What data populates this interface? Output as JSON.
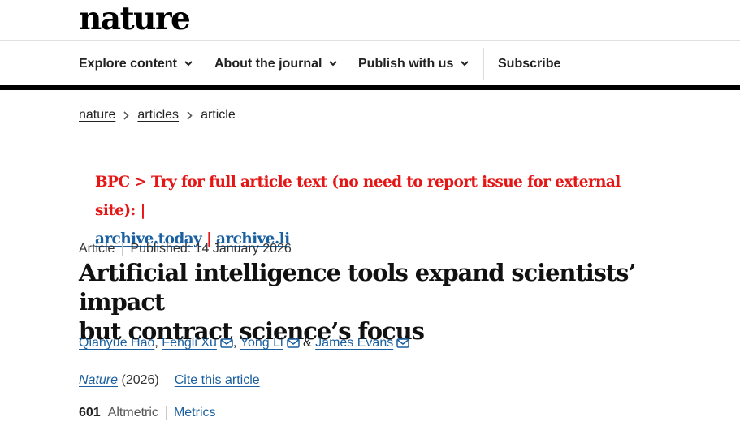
{
  "header": {
    "logo": "nature"
  },
  "nav": {
    "explore": "Explore content",
    "about": "About the journal",
    "publish": "Publish with us",
    "subscribe": "Subscribe"
  },
  "breadcrumb": {
    "home": "nature",
    "section": "articles",
    "current": "article"
  },
  "bpc": {
    "text": "BPC > Try for full article text (no need to report issue for external site): |",
    "link1": "archive.today",
    "sep": "|",
    "link2": "archive.li"
  },
  "article": {
    "type": "Article",
    "published": "Published: 14 January 2026",
    "title_line1": "Artificial intelligence tools expand scientists’ impact",
    "title_line2": "but contract science’s focus"
  },
  "authors": {
    "a1": "Qianyue Hao",
    "comma1": ",",
    "a2": "Fengli Xu",
    "comma2": ",",
    "a3": "Yong Li",
    "amp": "&",
    "a4": "James Evans"
  },
  "citation": {
    "journal": "Nature",
    "year": "(2026)",
    "cite": "Cite this article"
  },
  "metrics": {
    "count": "601",
    "label": "Altmetric",
    "link": "Metrics"
  },
  "colors": {
    "link": "#1a5fa0",
    "alert": "#e41616",
    "rule": "#000000"
  },
  "icons": {
    "chevron": "chevron-down-icon",
    "crumb": "chevron-right-icon",
    "mail": "envelope-icon"
  }
}
